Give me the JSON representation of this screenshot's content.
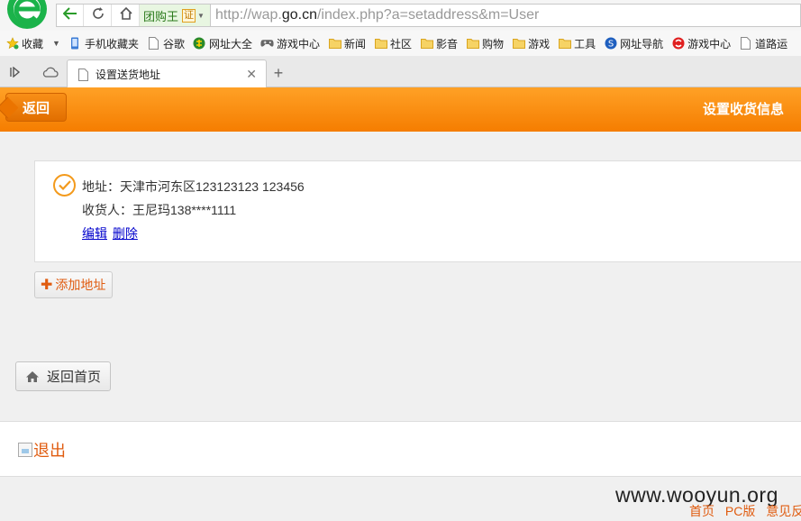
{
  "browser": {
    "site_badge": "团购王",
    "site_badge_cert": "证",
    "url_prefix": "http://wap.",
    "url_host": "go.cn",
    "url_path": "/index.php?a=setaddress&m=User",
    "bookmarks": [
      {
        "label": "收藏",
        "icon": "star-icon"
      },
      {
        "label": "手机收藏夹",
        "icon": "phone-icon"
      },
      {
        "label": "谷歌",
        "icon": "page-icon"
      },
      {
        "label": "网址大全",
        "icon": "globe-icon"
      },
      {
        "label": "游戏中心",
        "icon": "gamepad-icon"
      },
      {
        "label": "新闻",
        "icon": "folder-icon"
      },
      {
        "label": "社区",
        "icon": "folder-icon"
      },
      {
        "label": "影音",
        "icon": "folder-icon"
      },
      {
        "label": "购物",
        "icon": "folder-icon"
      },
      {
        "label": "游戏",
        "icon": "folder-icon"
      },
      {
        "label": "工具",
        "icon": "folder-icon"
      },
      {
        "label": "网址导航",
        "icon": "sogou-icon"
      },
      {
        "label": "游戏中心",
        "icon": "game-s-icon"
      },
      {
        "label": "道路运",
        "icon": "page-icon"
      }
    ],
    "tab_title": "设置送货地址"
  },
  "header": {
    "back_label": "返回",
    "title": "设置收货信息"
  },
  "address": {
    "address_line": "地址：天津市河东区123123123 123456",
    "receiver_line": "收货人：王尼玛138****1111",
    "edit_label": "编辑",
    "delete_label": "删除"
  },
  "add_address_label": "添加地址",
  "home_label": "返回首页",
  "logout_label": "退出",
  "watermark": "www.wooyun.org",
  "footer_links": [
    "首页",
    "PC版",
    "意见反馈"
  ],
  "colors": {
    "accent": "#f57d00",
    "link": "#0000cc",
    "orange_text": "#e05c10"
  }
}
